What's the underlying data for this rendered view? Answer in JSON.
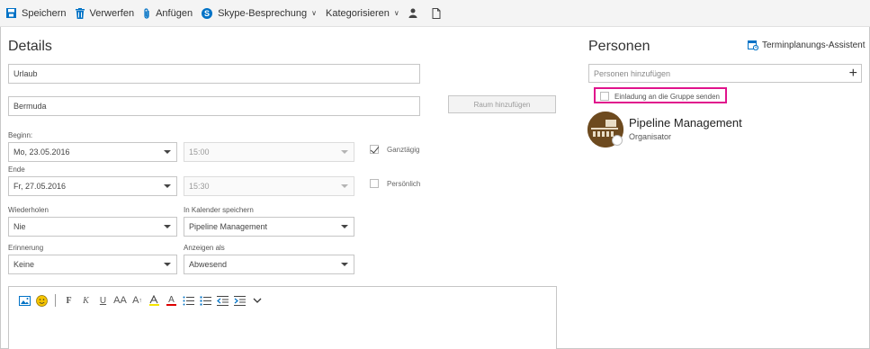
{
  "toolbar": {
    "save": "Speichern",
    "discard": "Verwerfen",
    "attach": "Anfügen",
    "skype": "Skype-Besprechung",
    "categorize": "Kategorisieren",
    "icons": [
      "save-icon",
      "trash-icon",
      "paperclip-icon",
      "skype-icon",
      "person-icon",
      "note-icon"
    ]
  },
  "details": {
    "heading": "Details",
    "subject": "Urlaub",
    "location": "Bermuda",
    "add_room_button": "Raum hinzufügen",
    "start_label": "Beginn:",
    "start_date": "Mo, 23.05.2016",
    "start_time": "15:00",
    "all_day_label": "Ganztägig",
    "all_day_checked": true,
    "end_label": "Ende",
    "end_date": "Fr, 27.05.2016",
    "end_time": "15:30",
    "private_label": "Persönlich",
    "private_checked": false,
    "repeat_label": "Wiederholen",
    "repeat_value": "Nie",
    "calendar_label": "In Kalender speichern",
    "calendar_value": "Pipeline Management",
    "reminder_label": "Erinnerung",
    "reminder_value": "Keine",
    "show_as_label": "Anzeigen als",
    "show_as_value": "Abwesend"
  },
  "editor": {
    "tools": [
      "insert-picture-icon",
      "emoji-icon",
      "bold-icon",
      "italic-icon",
      "underline-icon",
      "font-size-icon",
      "grow-font-icon",
      "highlight-icon",
      "font-color-icon",
      "bullets-icon",
      "numbering-icon",
      "decrease-indent-icon",
      "increase-indent-icon",
      "more-icon"
    ],
    "bold_glyph": "F",
    "italic_glyph": "K",
    "underline_glyph": "U",
    "font_size_glyph": "AA",
    "grow_glyph": "A",
    "font_color_glyph": "A"
  },
  "people": {
    "heading": "Personen",
    "scheduling_assistant": "Terminplanungs-Assistent",
    "add_placeholder": "Personen hinzufügen",
    "add_plus": "+",
    "invite_group_label": "Einladung an die Gruppe senden",
    "invite_group_checked": false,
    "attendee_name": "Pipeline Management",
    "attendee_role": "Organisator"
  },
  "colors": {
    "accent": "#0072c6",
    "highlight": "#e0138c",
    "avatar": "#6d4a1f"
  }
}
